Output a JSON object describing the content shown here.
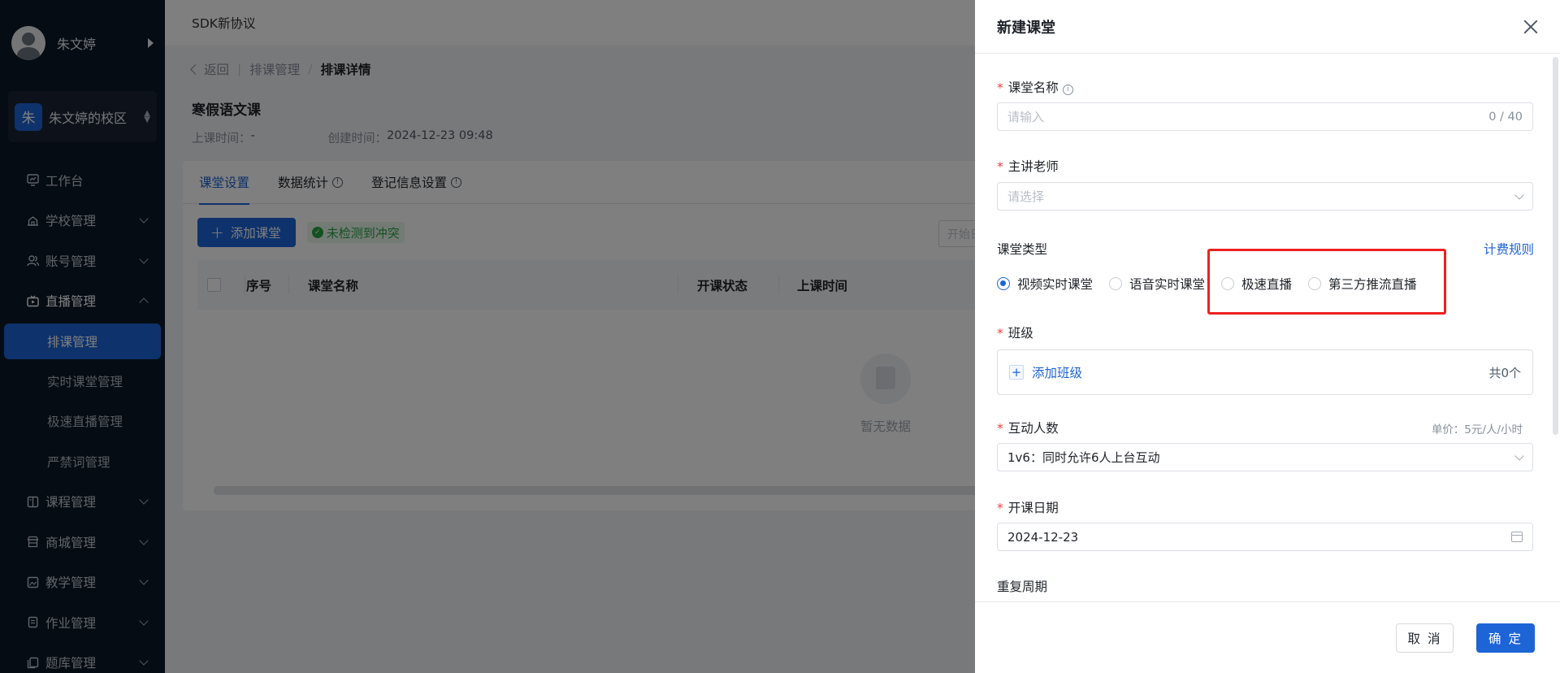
{
  "sidebar": {
    "user_name": "朱文婷",
    "campus_badge": "朱",
    "campus_name": "朱文婷的校区",
    "menu": {
      "workbench": "工作台",
      "school": "学校管理",
      "account": "账号管理",
      "live": "直播管理",
      "live_sub": {
        "schedule": "排课管理",
        "realtime": "实时课堂管理",
        "fast_live": "极速直播管理",
        "banned_words": "严禁词管理"
      },
      "course": "课程管理",
      "mall": "商城管理",
      "teaching": "教学管理",
      "homework": "作业管理",
      "question_bank": "题库管理"
    }
  },
  "main": {
    "top_title": "SDK新协议",
    "breadcrumb": {
      "back": "返回",
      "parent": "排课管理",
      "sep": "/",
      "current": "排课详情"
    },
    "course_title": "寒假语文课",
    "meta": {
      "class_time_label": "上课时间：",
      "class_time_value": "-",
      "created_label": "创建时间：",
      "created_value": "2024-12-23 09:48"
    },
    "tabs": {
      "settings": "课堂设置",
      "stats": "数据统计",
      "register": "登记信息设置"
    },
    "add_button": "添加课堂",
    "conflict_badge": "未检测到冲突",
    "date_placeholder": "开始日",
    "table_headers": {
      "index": "序号",
      "name": "课堂名称",
      "status": "开课状态",
      "time": "上课时间"
    },
    "empty_text": "暂无数据"
  },
  "drawer": {
    "title": "新建课堂",
    "fields": {
      "name_label": "课堂名称",
      "name_placeholder": "请输入",
      "name_count": "0 / 40",
      "teacher_label": "主讲老师",
      "teacher_placeholder": "请选择",
      "type_label": "课堂类型",
      "billing_link": "计费规则",
      "types": {
        "video": "视频实时课堂",
        "voice": "语音实时课堂",
        "fast": "极速直播",
        "third": "第三方推流直播"
      },
      "selected_type": "video",
      "class_label": "班级",
      "add_class": "添加班级",
      "class_total": "共0个",
      "interact_label": "互动人数",
      "unit_price": "单价：5元/人/小时",
      "interact_value": "1v6：同时允许6人上台互动",
      "date_label": "开课日期",
      "date_value": "2024-12-23",
      "repeat_label": "重复周期"
    },
    "cancel": "取 消",
    "confirm": "确 定"
  },
  "colors": {
    "primary": "#1d64d6",
    "sidebar_bg": "#0c1827",
    "danger": "#f53f3f",
    "success": "#2ba244",
    "highlight": "#ee2020"
  }
}
